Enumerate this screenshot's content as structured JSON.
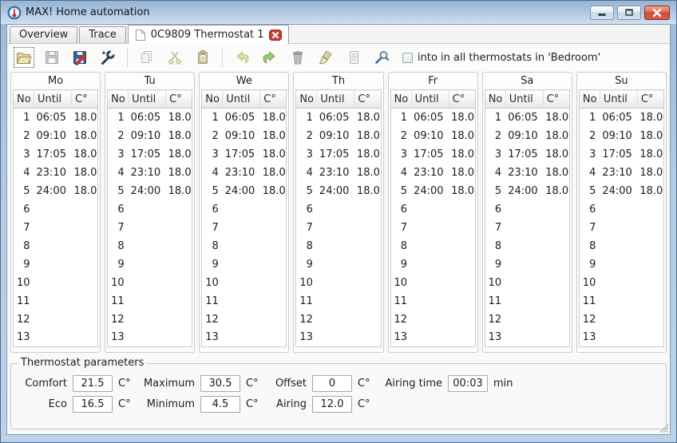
{
  "window": {
    "title": "MAX! Home automation",
    "controls": [
      "minimize",
      "maximize",
      "close"
    ]
  },
  "tabs": [
    {
      "label": "Overview",
      "active": false
    },
    {
      "label": "Trace",
      "active": false
    },
    {
      "label": "0C9809 Thermostat 1",
      "active": true,
      "closable": true
    }
  ],
  "toolbar": {
    "buttons": [
      {
        "name": "open",
        "disabled": false
      },
      {
        "name": "save",
        "disabled": true
      },
      {
        "name": "save-as",
        "disabled": false
      },
      {
        "name": "configure",
        "disabled": false
      },
      {
        "name": "copy",
        "disabled": true
      },
      {
        "name": "cut",
        "disabled": true
      },
      {
        "name": "paste",
        "disabled": true
      },
      {
        "name": "undo",
        "disabled": true
      },
      {
        "name": "redo",
        "disabled": false
      },
      {
        "name": "delete",
        "disabled": false
      },
      {
        "name": "brush",
        "disabled": false
      },
      {
        "name": "notes",
        "disabled": true
      },
      {
        "name": "find",
        "disabled": false
      }
    ],
    "checkbox": {
      "label": "into in all thermostats in 'Bedroom'",
      "checked": false
    }
  },
  "schedule": {
    "days": [
      "Mo",
      "Tu",
      "We",
      "Th",
      "Fr",
      "Sa",
      "Su"
    ],
    "columns": [
      "No",
      "Until",
      "C°"
    ],
    "same_rows_for_all_days": true,
    "rows": [
      {
        "no": "1",
        "until": "06:05",
        "temp": "18.0"
      },
      {
        "no": "2",
        "until": "09:10",
        "temp": "18.0"
      },
      {
        "no": "3",
        "until": "17:05",
        "temp": "18.0"
      },
      {
        "no": "4",
        "until": "23:10",
        "temp": "18.0"
      },
      {
        "no": "5",
        "until": "24:00",
        "temp": "18.0"
      },
      {
        "no": "6",
        "until": "",
        "temp": ""
      },
      {
        "no": "7",
        "until": "",
        "temp": ""
      },
      {
        "no": "8",
        "until": "",
        "temp": ""
      },
      {
        "no": "9",
        "until": "",
        "temp": ""
      },
      {
        "no": "10",
        "until": "",
        "temp": ""
      },
      {
        "no": "11",
        "until": "",
        "temp": ""
      },
      {
        "no": "12",
        "until": "",
        "temp": ""
      },
      {
        "no": "13",
        "until": "",
        "temp": ""
      }
    ]
  },
  "parameters": {
    "title": "Thermostat parameters",
    "rows": [
      [
        {
          "label": "Comfort",
          "value": "21.5",
          "unit": "C°"
        },
        {
          "label": "Maximum",
          "value": "30.5",
          "unit": "C°"
        },
        {
          "label": "Offset",
          "value": "0",
          "unit": "C°"
        },
        {
          "label": "Airing time",
          "value": "00:03",
          "unit": "min"
        }
      ],
      [
        {
          "label": "Eco",
          "value": "16.5",
          "unit": "C°"
        },
        {
          "label": "Minimum",
          "value": "4.5",
          "unit": "C°"
        },
        {
          "label": "Airing",
          "value": "12.0",
          "unit": "C°"
        }
      ]
    ]
  }
}
